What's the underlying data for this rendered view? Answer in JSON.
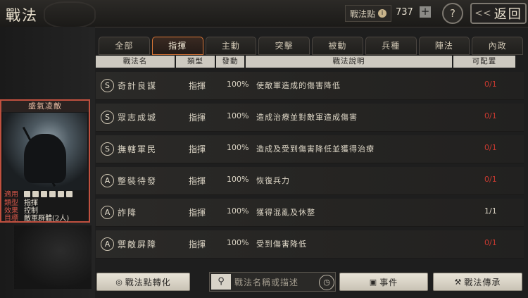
{
  "header": {
    "title": "戰法",
    "points_label": "戰法點",
    "points_value": "737",
    "plus_label": "+",
    "help_label": "?",
    "back_label": "返回"
  },
  "card": {
    "title": "盛氣凌敵",
    "rows": [
      {
        "key": "適用",
        "value": ""
      },
      {
        "key": "類型",
        "value": "指揮"
      },
      {
        "key": "效果",
        "value": "控制"
      },
      {
        "key": "目標",
        "value": "敵軍群體(2人)"
      }
    ]
  },
  "tabs": [
    {
      "label": "全部",
      "active": false
    },
    {
      "label": "指揮",
      "active": true
    },
    {
      "label": "主動",
      "active": false
    },
    {
      "label": "突擊",
      "active": false
    },
    {
      "label": "被動",
      "active": false
    },
    {
      "label": "兵種",
      "active": false
    },
    {
      "label": "陣法",
      "active": false
    },
    {
      "label": "內政",
      "active": false
    }
  ],
  "table": {
    "headers": [
      "戰法名",
      "類型",
      "發動",
      "戰法說明",
      "可配置"
    ],
    "rows": [
      {
        "grade": "S",
        "name": "奇計良謀",
        "type": "指揮",
        "rate": "100%",
        "desc": "使敵軍造成的傷害降低",
        "config": "0/1",
        "config_red": true
      },
      {
        "grade": "S",
        "name": "眾志成城",
        "type": "指揮",
        "rate": "100%",
        "desc": "造成治療並對敵軍造成傷害",
        "config": "0/1",
        "config_red": true
      },
      {
        "grade": "S",
        "name": "撫轄軍民",
        "type": "指揮",
        "rate": "100%",
        "desc": "造成及受到傷害降低並獲得治療",
        "config": "0/1",
        "config_red": true
      },
      {
        "grade": "A",
        "name": "整裝待發",
        "type": "指揮",
        "rate": "100%",
        "desc": "恢復兵力",
        "config": "0/1",
        "config_red": true
      },
      {
        "grade": "A",
        "name": "詐降",
        "type": "指揮",
        "rate": "100%",
        "desc": "獲得混亂及休整",
        "config": "1/1",
        "config_red": false
      },
      {
        "grade": "A",
        "name": "禦敵屏障",
        "type": "指揮",
        "rate": "100%",
        "desc": "受到傷害降低",
        "config": "0/1",
        "config_red": true
      }
    ]
  },
  "footer": {
    "convert_label": "戰法點轉化",
    "search_placeholder": "戰法名稱或描述",
    "event_label": "事件",
    "inherit_label": "戰法傳承"
  },
  "colors": {
    "accent_tab": "#d87536",
    "card_border": "#c0503f",
    "config_red": "#c93a30"
  }
}
